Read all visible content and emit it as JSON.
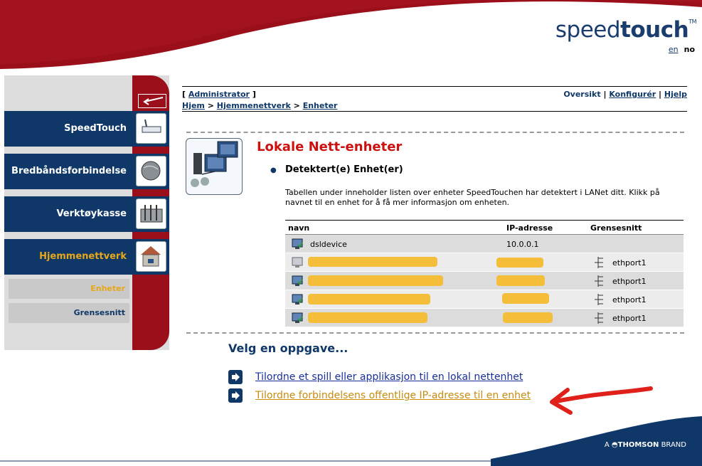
{
  "brand": {
    "logo_light": "speed",
    "logo_bold": "touch",
    "tm": "TM",
    "footer_prefix": "A",
    "footer_bold": "THOMSON",
    "footer_suffix": "BRAND"
  },
  "lang": {
    "en": "en",
    "no": "no"
  },
  "sidebar": {
    "items": [
      {
        "label": "SpeedTouch",
        "icon": "router-icon"
      },
      {
        "label": "Bredbåndsforbindelse",
        "icon": "globe-icon"
      },
      {
        "label": "Verktøykasse",
        "icon": "toolbox-icon"
      },
      {
        "label": "Hjemmenettverk",
        "icon": "home-network-icon"
      }
    ],
    "subitems": [
      {
        "label": "Enheter"
      },
      {
        "label": "Grensesnitt"
      }
    ]
  },
  "topbar": {
    "user": "Administrator",
    "crumb_home": "Hjem",
    "crumb_net": "Hjemmenettverk",
    "crumb_devices": "Enheter",
    "overview": "Oversikt",
    "configure": "Konfigurér",
    "help": "Hjelp"
  },
  "page": {
    "title": "Lokale Nett-enheter",
    "section": "Detektert(e) Enhet(er)",
    "description": "Tabellen under inneholder listen over enheter SpeedTouchen har detektert i LANet ditt. Klikk på navnet til en enhet for å få mer informasjon om enheten."
  },
  "table": {
    "headers": {
      "name": "navn",
      "ip": "IP-adresse",
      "iface": "Grensesnitt"
    },
    "rows": [
      {
        "name": "dsldevice",
        "ip": "10.0.0.1",
        "iface": ""
      },
      {
        "name": "",
        "ip": "",
        "iface": "ethport1"
      },
      {
        "name": "",
        "ip": "",
        "iface": "ethport1"
      },
      {
        "name": "",
        "ip": "",
        "iface": "ethport1"
      },
      {
        "name": "",
        "ip": "",
        "iface": "ethport1"
      }
    ]
  },
  "tasks": {
    "title": "Velg en oppgave...",
    "items": [
      "Tilordne et spill eller applikasjon til en lokal nettenhet",
      "Tilordne forbindelsens offentlige IP-adresse til en enhet"
    ]
  },
  "colors": {
    "brand_red": "#9b0f1b",
    "brand_blue": "#0f3868",
    "highlight": "#e6a719",
    "title_red": "#cc1111",
    "annotation": "#e0201a"
  }
}
